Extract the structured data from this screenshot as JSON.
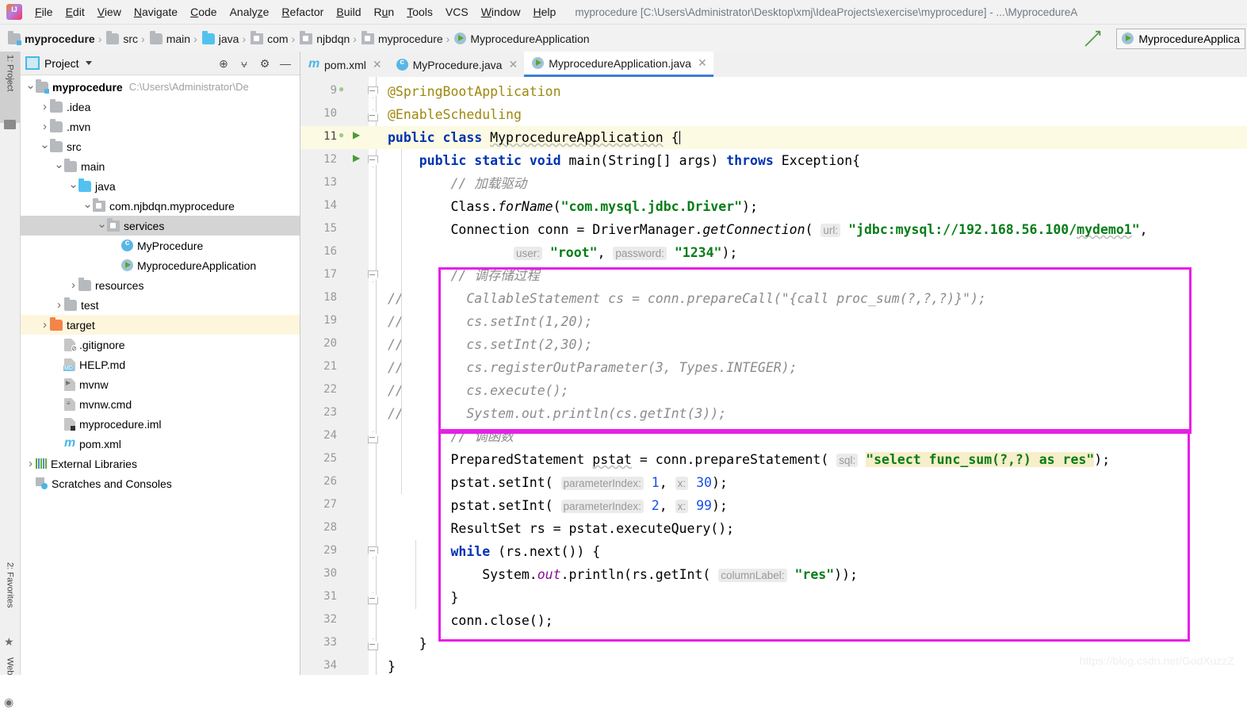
{
  "window": {
    "title": "myprocedure [C:\\Users\\Administrator\\Desktop\\xmj\\IdeaProjects\\exercise\\myprocedure] - ...\\MyprocedureA",
    "logo": "intellij-idea-logo"
  },
  "menubar": {
    "items": [
      "File",
      "Edit",
      "View",
      "Navigate",
      "Code",
      "Analyze",
      "Refactor",
      "Build",
      "Run",
      "Tools",
      "VCS",
      "Window",
      "Help"
    ]
  },
  "breadcrumb": {
    "items": [
      {
        "label": "myprocedure",
        "icon": "module-folder-icon"
      },
      {
        "label": "src",
        "icon": "folder-icon"
      },
      {
        "label": "main",
        "icon": "folder-icon"
      },
      {
        "label": "java",
        "icon": "source-folder-icon"
      },
      {
        "label": "com",
        "icon": "package-icon"
      },
      {
        "label": "njbdqn",
        "icon": "package-icon"
      },
      {
        "label": "myprocedure",
        "icon": "package-icon"
      },
      {
        "label": "MyprocedureApplication",
        "icon": "spring-class-icon"
      }
    ],
    "separator": "›",
    "run_config": {
      "label": "MyprocedureApplica",
      "icon": "spring-run-icon"
    },
    "back_arrow_icon": "navigate-back-icon"
  },
  "toolstrip": {
    "buttons": [
      {
        "label": "1: Project",
        "icon": "project-icon",
        "active": true
      },
      {
        "label": "2: Favorites",
        "icon": "star-icon",
        "active": false
      },
      {
        "label": "Web",
        "icon": "web-icon",
        "active": false
      }
    ]
  },
  "project_panel": {
    "header": {
      "title": "Project",
      "icon": "project-view-icon",
      "dropdown_icon": "chevron-down-icon",
      "actions": [
        {
          "name": "locate-icon",
          "glyph": "⊕"
        },
        {
          "name": "collapse-all-icon",
          "glyph": "⩝"
        },
        {
          "name": "gear-icon",
          "glyph": "⚙"
        },
        {
          "name": "hide-icon",
          "glyph": "—"
        }
      ]
    },
    "tree": [
      {
        "label": "myprocedure",
        "path": "C:\\Users\\Administrator\\De",
        "indent": 0,
        "arrow": "down",
        "icon": "module-folder-icon",
        "bold": true,
        "state": "normal"
      },
      {
        "label": ".idea",
        "indent": 1,
        "arrow": "right",
        "icon": "folder-icon",
        "state": "normal"
      },
      {
        "label": ".mvn",
        "indent": 1,
        "arrow": "right",
        "icon": "folder-icon",
        "state": "normal"
      },
      {
        "label": "src",
        "indent": 1,
        "arrow": "down",
        "icon": "folder-icon",
        "state": "normal"
      },
      {
        "label": "main",
        "indent": 2,
        "arrow": "down",
        "icon": "folder-icon",
        "state": "normal"
      },
      {
        "label": "java",
        "indent": 3,
        "arrow": "down",
        "icon": "source-folder-icon",
        "state": "normal"
      },
      {
        "label": "com.njbdqn.myprocedure",
        "indent": 4,
        "arrow": "down",
        "icon": "package-icon",
        "state": "normal"
      },
      {
        "label": "services",
        "indent": 5,
        "arrow": "down",
        "icon": "package-icon",
        "state": "selected"
      },
      {
        "label": "MyProcedure",
        "indent": 6,
        "arrow": "none",
        "icon": "class-icon",
        "state": "normal"
      },
      {
        "label": "MyprocedureApplication",
        "indent": 6,
        "arrow": "none",
        "icon": "spring-class-icon",
        "state": "normal"
      },
      {
        "label": "resources",
        "indent": 3,
        "arrow": "right",
        "icon": "resource-folder-icon",
        "state": "normal"
      },
      {
        "label": "test",
        "indent": 2,
        "arrow": "right",
        "icon": "folder-icon",
        "state": "normal"
      },
      {
        "label": "target",
        "indent": 1,
        "arrow": "right",
        "icon": "excluded-folder-icon",
        "state": "highlight"
      },
      {
        "label": ".gitignore",
        "indent": 2,
        "arrow": "none",
        "icon": "gitignore-file-icon",
        "state": "normal"
      },
      {
        "label": "HELP.md",
        "indent": 2,
        "arrow": "none",
        "icon": "markdown-file-icon",
        "state": "normal"
      },
      {
        "label": "mvnw",
        "indent": 2,
        "arrow": "none",
        "icon": "shell-file-icon",
        "state": "normal"
      },
      {
        "label": "mvnw.cmd",
        "indent": 2,
        "arrow": "none",
        "icon": "cmd-file-icon",
        "state": "normal"
      },
      {
        "label": "myprocedure.iml",
        "indent": 2,
        "arrow": "none",
        "icon": "iml-file-icon",
        "state": "normal"
      },
      {
        "label": "pom.xml",
        "indent": 2,
        "arrow": "none",
        "icon": "maven-file-icon",
        "state": "normal"
      },
      {
        "label": "External Libraries",
        "indent": 0,
        "arrow": "right",
        "icon": "libraries-icon",
        "state": "normal"
      },
      {
        "label": "Scratches and Consoles",
        "indent": 0,
        "arrow": "none",
        "icon": "scratches-icon",
        "state": "normal"
      }
    ]
  },
  "editor": {
    "tabs": [
      {
        "label": "pom.xml",
        "icon": "maven-file-icon",
        "active": false,
        "close_icon": "close-icon"
      },
      {
        "label": "MyProcedure.java",
        "icon": "class-icon",
        "active": false,
        "close_icon": "close-icon"
      },
      {
        "label": "MyprocedureApplication.java",
        "icon": "spring-class-icon",
        "active": true,
        "close_icon": "close-icon"
      }
    ],
    "current_line": 11,
    "lines": [
      {
        "n": 9,
        "text": "@SpringBootApplication"
      },
      {
        "n": 10,
        "text": "@EnableScheduling"
      },
      {
        "n": 11,
        "text": "public class MyprocedureApplication {"
      },
      {
        "n": 12,
        "text": "    public static void main(String[] args) throws Exception{"
      },
      {
        "n": 13,
        "text": "        // 加载驱动"
      },
      {
        "n": 14,
        "text": "        Class.forName(\"com.mysql.jdbc.Driver\");"
      },
      {
        "n": 15,
        "text": "        Connection conn = DriverManager.getConnection( url: \"jdbc:mysql://192.168.56.100/mydemo1\","
      },
      {
        "n": 16,
        "text": "                user: \"root\", password: \"1234\");"
      },
      {
        "n": 17,
        "text": "        // 调存储过程"
      },
      {
        "n": 18,
        "text": "//        CallableStatement cs = conn.prepareCall(\"{call proc_sum(?,?,?)}\");"
      },
      {
        "n": 19,
        "text": "//        cs.setInt(1,20);"
      },
      {
        "n": 20,
        "text": "//        cs.setInt(2,30);"
      },
      {
        "n": 21,
        "text": "//        cs.registerOutParameter(3, Types.INTEGER);"
      },
      {
        "n": 22,
        "text": "//        cs.execute();"
      },
      {
        "n": 23,
        "text": "//        System.out.println(cs.getInt(3));"
      },
      {
        "n": 24,
        "text": "        // 调函数"
      },
      {
        "n": 25,
        "text": "        PreparedStatement pstat = conn.prepareStatement( sql: \"select func_sum(?,?) as res\");"
      },
      {
        "n": 26,
        "text": "        pstat.setInt( parameterIndex: 1, x: 30);"
      },
      {
        "n": 27,
        "text": "        pstat.setInt( parameterIndex: 2, x: 99);"
      },
      {
        "n": 28,
        "text": "        ResultSet rs = pstat.executeQuery();"
      },
      {
        "n": 29,
        "text": "        while (rs.next()) {"
      },
      {
        "n": 30,
        "text": "            System.out.println(rs.getInt( columnLabel: \"res\"));"
      },
      {
        "n": 31,
        "text": "        }"
      },
      {
        "n": 32,
        "text": "        conn.close();"
      },
      {
        "n": 33,
        "text": "    }"
      },
      {
        "n": 34,
        "text": "}"
      }
    ],
    "annotations": [
      {
        "name": "stored-procedure-highlight-box",
        "color": "#e81ee8"
      },
      {
        "name": "function-call-highlight-box",
        "color": "#e81ee8"
      }
    ],
    "watermark": "https://blog.csdn.net/GodXuzzZ"
  }
}
